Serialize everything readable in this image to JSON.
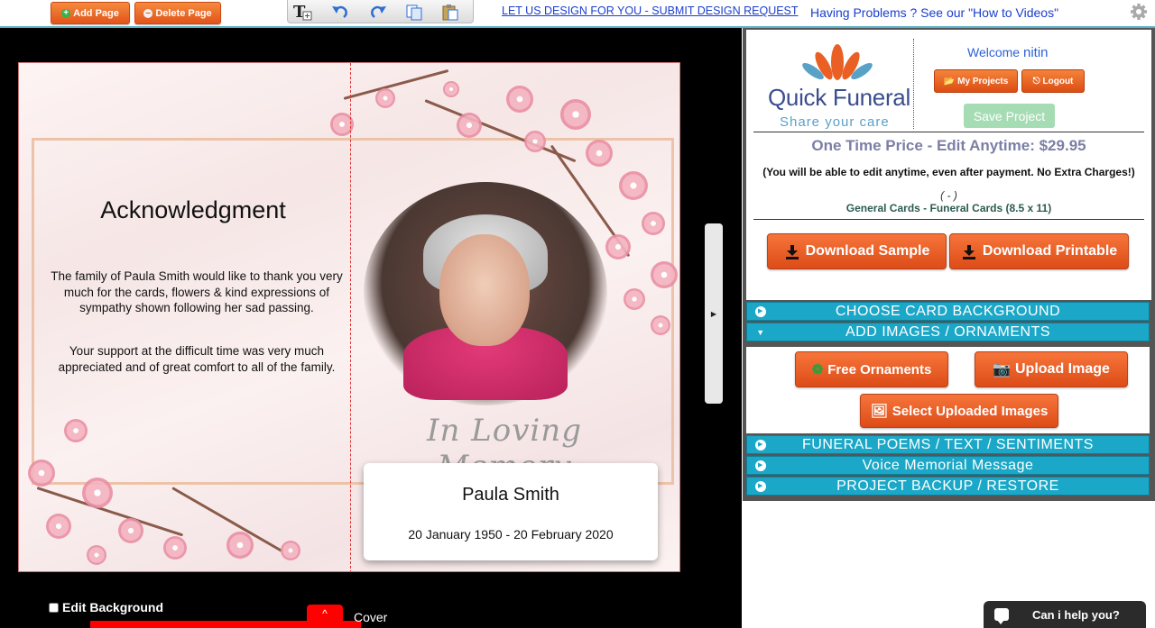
{
  "toolbar": {
    "add_page": "Add Page",
    "delete_page": "Delete Page",
    "design_request": "LET US DESIGN FOR YOU - SUBMIT DESIGN REQUEST",
    "help": "Having Problems ? See our \"How to Videos\""
  },
  "card": {
    "ack_title": "Acknowledgment",
    "ack_p1": "The family of Paula Smith would like to thank you very much for the cards, flowers & kind expressions of sympathy shown following her sad passing.",
    "ack_p2": "Your support at the difficult time was very much appreciated and of great comfort to all of the family.",
    "memory_text": "In Loving Memory",
    "name": "Paula Smith",
    "dates": "20 January 1950 - 20 February 2020"
  },
  "canvas_footer": {
    "edit_background": "Edit Background",
    "page_tab": "^",
    "page_name": "Cover"
  },
  "panel": {
    "logo_main": "Quick Funeral",
    "logo_tag": "Share your care",
    "welcome_label": "Welcome",
    "username": "nitin",
    "my_projects": "My Projects",
    "logout": "Logout",
    "save_project": "Save Project",
    "price": "One Time Price - Edit Anytime: $29.95",
    "price_note": "(You will be able to edit anytime, even after payment. No Extra Charges!)",
    "card_dim": "( - )",
    "card_type": "General Cards - Funeral Cards (8.5 x 11)",
    "download_sample": "Download Sample",
    "download_printable": "Download Printable",
    "sections": [
      "CHOOSE CARD BACKGROUND",
      "ADD IMAGES / ORNAMENTS",
      "FUNERAL POEMS / TEXT / SENTIMENTS",
      "Voice Memorial Message",
      "PROJECT BACKUP / RESTORE"
    ],
    "free_ornaments": "Free Ornaments",
    "upload_image": "Upload Image",
    "select_uploaded": "Select Uploaded Images"
  },
  "chat": {
    "label": "Can i help you?"
  },
  "colors": {
    "accent": "#1ba7c7",
    "button": "#e95f24",
    "link": "#1a3ecf"
  }
}
